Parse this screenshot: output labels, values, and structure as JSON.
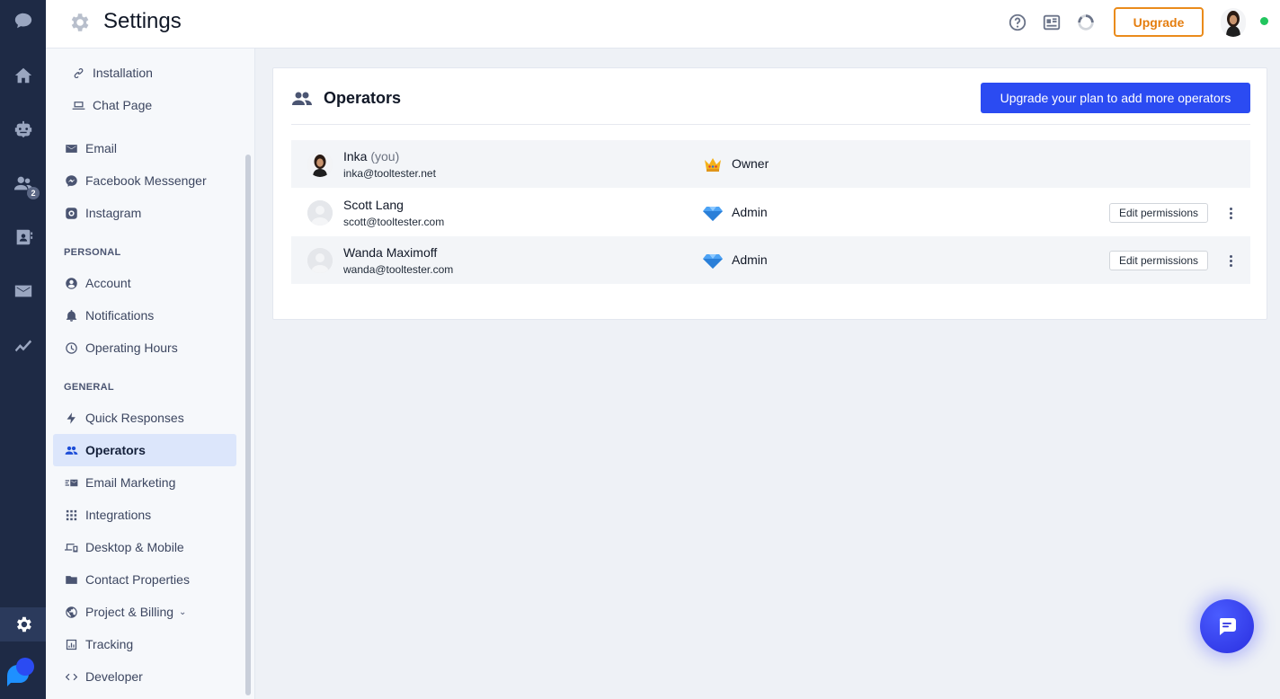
{
  "topbar": {
    "title": "Settings",
    "upgrade_label": "Upgrade",
    "online_color": "#22c55e"
  },
  "rail": {
    "icons": [
      "chat-icon",
      "home-icon",
      "bot-icon",
      "contacts-icon",
      "address-book-icon",
      "mail-icon",
      "analytics-icon",
      "settings-icon"
    ],
    "contacts_badge": "2"
  },
  "sidebar": {
    "items_top": [
      {
        "label": "Installation",
        "icon": "link-icon"
      },
      {
        "label": "Chat Page",
        "icon": "laptop-icon"
      },
      {
        "label": "Email",
        "icon": "email-icon"
      },
      {
        "label": "Facebook Messenger",
        "icon": "messenger-icon"
      },
      {
        "label": "Instagram",
        "icon": "instagram-icon"
      }
    ],
    "personal_header": "PERSONAL",
    "personal": [
      {
        "label": "Account",
        "icon": "account-icon"
      },
      {
        "label": "Notifications",
        "icon": "bell-icon"
      },
      {
        "label": "Operating Hours",
        "icon": "clock-icon"
      }
    ],
    "general_header": "GENERAL",
    "general": [
      {
        "label": "Quick Responses",
        "icon": "bolt-icon"
      },
      {
        "label": "Operators",
        "icon": "people-icon"
      },
      {
        "label": "Email Marketing",
        "icon": "email-marketing-icon"
      },
      {
        "label": "Integrations",
        "icon": "grid-icon"
      },
      {
        "label": "Desktop & Mobile",
        "icon": "devices-icon"
      },
      {
        "label": "Contact Properties",
        "icon": "folder-icon"
      },
      {
        "label": "Project & Billing",
        "icon": "globe-icon"
      },
      {
        "label": "Tracking",
        "icon": "chart-icon"
      },
      {
        "label": "Developer",
        "icon": "code-icon"
      }
    ],
    "active": "Operators"
  },
  "operators": {
    "title": "Operators",
    "upgrade_button": "Upgrade your plan to add more operators",
    "edit_label": "Edit permissions",
    "rows": [
      {
        "name": "Inka",
        "you": "(you)",
        "email": "inka@tooltester.net",
        "role": "Owner",
        "role_icon": "crown-icon"
      },
      {
        "name": "Scott Lang",
        "you": "",
        "email": "scott@tooltester.com",
        "role": "Admin",
        "role_icon": "diamond-icon"
      },
      {
        "name": "Wanda Maximoff",
        "you": "",
        "email": "wanda@tooltester.com",
        "role": "Admin",
        "role_icon": "diamond-icon"
      }
    ]
  },
  "colors": {
    "accent": "#2b4bf2",
    "upgrade": "#ea8b1b",
    "rail_bg": "#1e2a45"
  }
}
